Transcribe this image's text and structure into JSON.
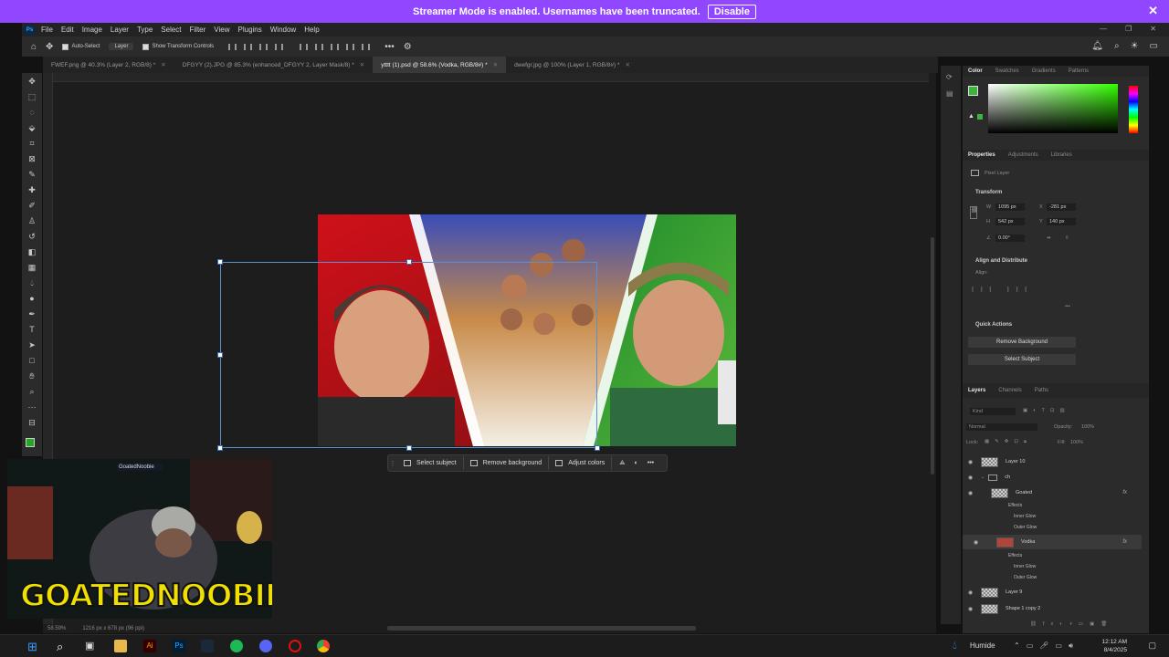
{
  "banner": {
    "text": "Streamer Mode is enabled. Usernames have been truncated.",
    "disable_label": "Disable"
  },
  "menubar": {
    "logo": "Ps",
    "items": [
      "File",
      "Edit",
      "Image",
      "Layer",
      "Type",
      "Select",
      "Filter",
      "View",
      "Plugins",
      "Window",
      "Help"
    ]
  },
  "options": {
    "auto_select": "Auto-Select",
    "layer_select": "Layer",
    "show_transform": "Show Transform Controls"
  },
  "tabs": [
    {
      "label": "FWEF.png @ 40.3% (Layer 2, RGB/8) *"
    },
    {
      "label": "DFGYY (2).JPG @ 85.3% (enhanced_DFGYY 2, Layer Mask/8) *"
    },
    {
      "label": "ytttt (1).psd @ 58.6% (Vodka, RGB/8#) *"
    },
    {
      "label": "dwefgr.jpg @ 100% (Layer 1, RGB/8#) *"
    }
  ],
  "contextbar": {
    "select_subject": "Select subject",
    "remove_background": "Remove background",
    "adjust_colors": "Adjust colors"
  },
  "status": {
    "zoom": "58.59%",
    "doc_size": "1216 px x 678 px (96 ppi)"
  },
  "webcam": {
    "tag": "GoatedNoobie",
    "overlay_name": "GOATEDNOOBIE"
  },
  "color_panel": {
    "tabs": [
      "Color",
      "Swatches",
      "Gradients",
      "Patterns"
    ],
    "fg_color": "#3db53d"
  },
  "properties": {
    "tabs": [
      "Properties",
      "Adjustments",
      "Libraries"
    ],
    "kind": "Pixel Layer",
    "transform_title": "Transform",
    "w_label": "W",
    "w": "1095 px",
    "x_label": "X",
    "x": "-281 px",
    "h_label": "H",
    "h": "542 px",
    "y_label": "Y",
    "y": "140 px",
    "angle": "0.00°",
    "align_title": "Align and Distribute",
    "align_label": "Align:",
    "quick_title": "Quick Actions",
    "remove_bg": "Remove Background",
    "select_subject": "Select Subject"
  },
  "layers_panel": {
    "tabs": [
      "Layers",
      "Channels",
      "Paths"
    ],
    "kind": "Kind",
    "blend": "Normal",
    "opacity_label": "Opacity:",
    "opacity": "100%",
    "lock_label": "Lock:",
    "fill_label": "Fill:",
    "fill": "100%",
    "layers": [
      {
        "name": "Layer 10"
      },
      {
        "name": "ch"
      },
      {
        "name": "Goated",
        "fx": "fx"
      },
      {
        "name": "Effects"
      },
      {
        "name": "Inner Glow"
      },
      {
        "name": "Outer Glow"
      },
      {
        "name": "Vodka",
        "fx": "fx"
      },
      {
        "name": "Effects"
      },
      {
        "name": "Inner Glow"
      },
      {
        "name": "Outer Glow"
      },
      {
        "name": "Layer 9"
      },
      {
        "name": "Shape 1 copy 2"
      }
    ]
  },
  "taskbar": {
    "weather": "Humide",
    "time": "12:12 AM",
    "date": "8/4/2025"
  }
}
